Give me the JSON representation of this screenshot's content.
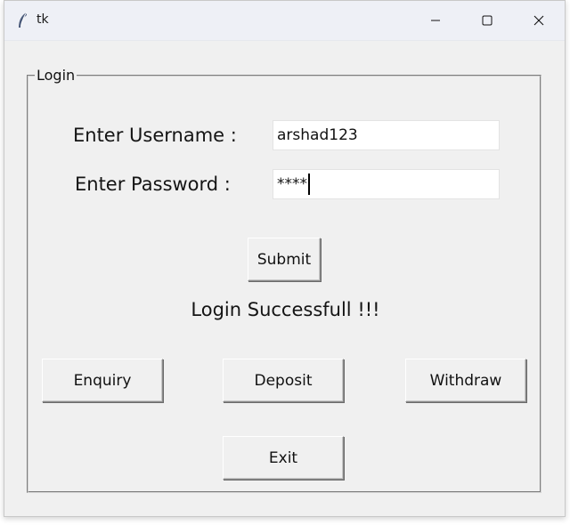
{
  "window": {
    "title": "tk",
    "minimize_icon": "minimize-icon",
    "maximize_icon": "maximize-icon",
    "close_icon": "close-icon",
    "app_icon": "feather-icon"
  },
  "login_frame": {
    "label": "Login",
    "username_label": "Enter Username :",
    "username_value": "arshad123",
    "password_label": "Enter Password :",
    "password_value": "****",
    "submit_label": "Submit",
    "status_message": "Login Successfull !!!"
  },
  "actions": {
    "enquiry_label": "Enquiry",
    "deposit_label": "Deposit",
    "withdraw_label": "Withdraw",
    "exit_label": "Exit"
  }
}
